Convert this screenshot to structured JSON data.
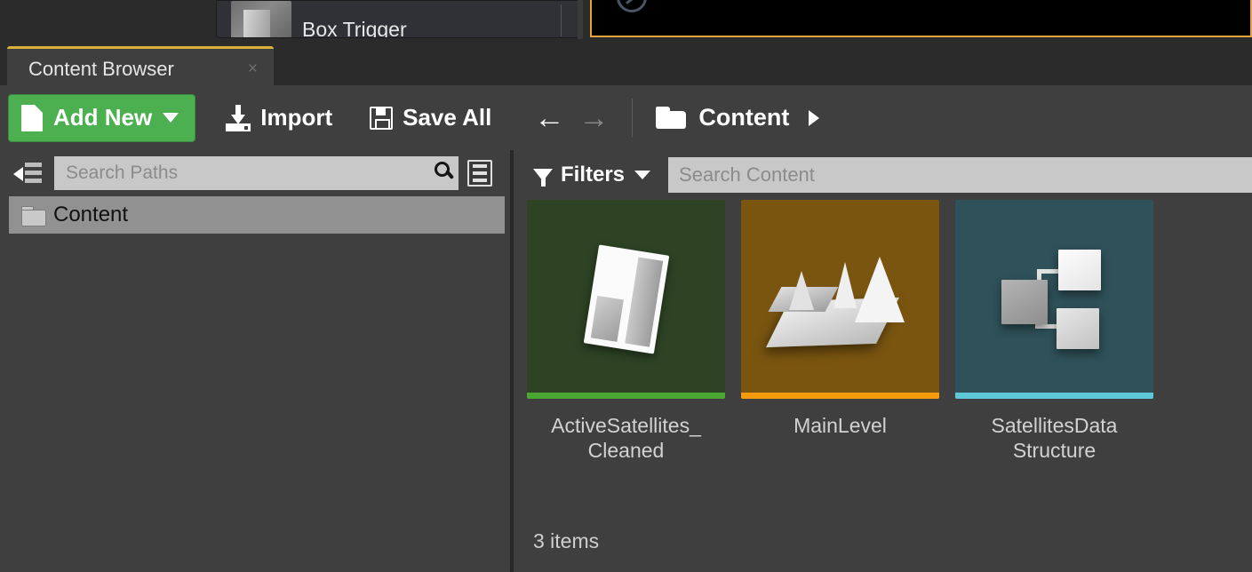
{
  "background": {
    "place_actors": {
      "item_label": "Box Trigger",
      "thumb_icon": "box-trigger-thumbnail"
    },
    "viewport": {
      "compass_icon": "viewport-compass-icon",
      "border_color": "#e8a33d",
      "background_color": "#000000"
    }
  },
  "window": {
    "tab": {
      "label": "Content Browser",
      "close_label": "×",
      "active_accent": "#d9b13b"
    }
  },
  "toolbar": {
    "add_new": {
      "label": "Add New",
      "icon": "new-page-icon",
      "caret_icon": "chevron-down-icon",
      "color": "#4caf50"
    },
    "import": {
      "label": "Import",
      "icon": "import-download-icon"
    },
    "save_all": {
      "label": "Save All",
      "icon": "floppy-disk-icon"
    },
    "nav": {
      "back_icon": "arrow-left-icon",
      "back_glyph": "←",
      "forward_icon": "arrow-right-icon",
      "forward_glyph": "→",
      "back_color": "#ffffff",
      "forward_color": "#8a8a8a"
    },
    "breadcrumb": {
      "folder_icon": "folder-icon",
      "label": "Content",
      "expand_icon": "triangle-right-icon"
    }
  },
  "sources_panel": {
    "collapse_icon": "collapse-panel-left-icon",
    "search": {
      "placeholder": "Search Paths",
      "value": "",
      "search_icon": "magnifier-icon"
    },
    "view_options_icon": "list-view-options-icon",
    "tree": [
      {
        "label": "Content",
        "icon": "folder-icon",
        "selected": true
      }
    ]
  },
  "asset_view": {
    "filters": {
      "label": "Filters",
      "funnel_icon": "filter-funnel-icon",
      "caret_icon": "chevron-down-icon"
    },
    "search": {
      "placeholder": "Search Content",
      "value": "",
      "search_icon": "search-icon"
    },
    "assets": [
      {
        "name": "ActiveSatellites_ Cleaned",
        "type_icon": "data-table-icon",
        "thumb_color": "#2d4324",
        "accent_color": "#4aa832"
      },
      {
        "name": "MainLevel",
        "type_icon": "level-icon",
        "thumb_color": "#7a5510",
        "accent_color": "#f59b0c"
      },
      {
        "name": "SatellitesData Structure",
        "type_icon": "struct-icon",
        "thumb_color": "#2f5159",
        "accent_color": "#5ec8d8"
      }
    ],
    "status": "3 items"
  }
}
